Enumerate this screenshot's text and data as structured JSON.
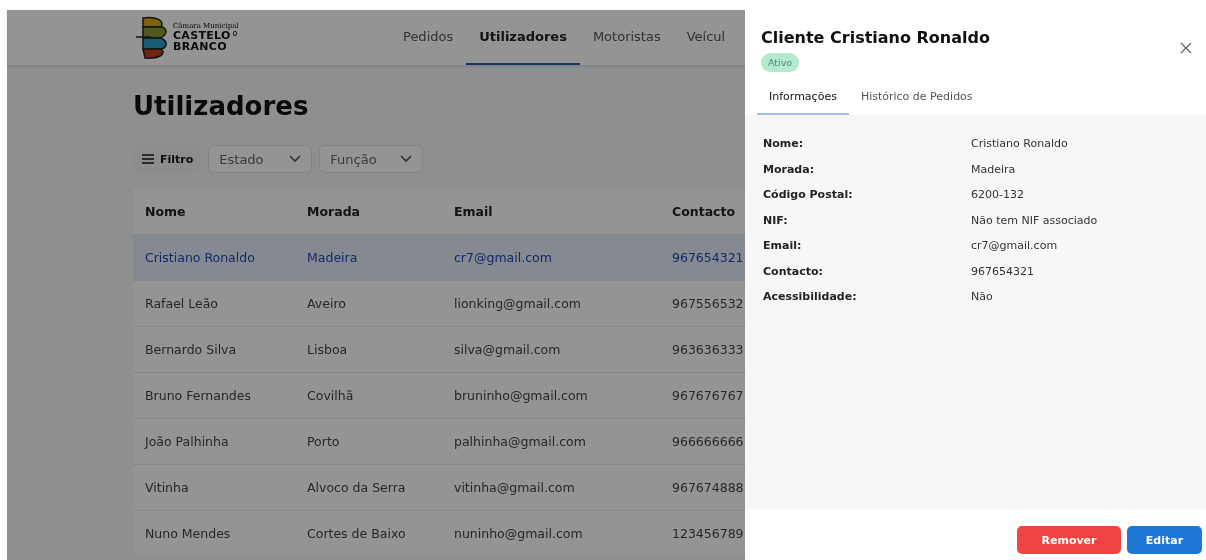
{
  "logo": {
    "subtitle": "Câmara Municipal",
    "name_line1": "CASTELO",
    "name_line2": "BRANCO",
    "mark": "o"
  },
  "nav": [
    {
      "label": "Pedidos",
      "selected": false
    },
    {
      "label": "Utilizadores",
      "selected": true
    },
    {
      "label": "Motoristas",
      "selected": false
    },
    {
      "label": "Veícul",
      "selected": false
    }
  ],
  "page_title": "Utilizadores",
  "filters": {
    "filter_button": "Filtro",
    "dropdowns": [
      "Estado",
      "Função"
    ]
  },
  "table": {
    "columns": [
      "Nome",
      "Morada",
      "Email",
      "Contacto"
    ],
    "rows": [
      {
        "cells": [
          "Cristiano Ronaldo",
          "Madeira",
          "cr7@gmail.com",
          "967654321"
        ],
        "selected": true
      },
      {
        "cells": [
          "Rafael Leão",
          "Aveiro",
          "lionking@gmail.com",
          "967556532"
        ],
        "selected": false
      },
      {
        "cells": [
          "Bernardo Silva",
          "Lisboa",
          "silva@gmail.com",
          "963636333"
        ],
        "selected": false
      },
      {
        "cells": [
          "Bruno Fernandes",
          "Covilhã",
          "bruninho@gmail.com",
          "967676767"
        ],
        "selected": false
      },
      {
        "cells": [
          "João Palhinha",
          "Porto",
          "palhinha@gmail.com",
          "966666666"
        ],
        "selected": false
      },
      {
        "cells": [
          "Vitinha",
          "Alvoco da Serra",
          "vitinha@gmail.com",
          "967674888"
        ],
        "selected": false
      },
      {
        "cells": [
          "Nuno Mendes",
          "Cortes de Baixo",
          "nuninho@gmail.com",
          "123456789"
        ],
        "selected": false
      }
    ]
  },
  "drawer": {
    "title": "Cliente Cristiano Ronaldo",
    "status": "Ativo",
    "tabs": [
      {
        "label": "Informações",
        "selected": true
      },
      {
        "label": "Histórico de Pedidos",
        "selected": false
      }
    ],
    "fields": [
      {
        "label": "Nome:",
        "value": "Cristiano Ronaldo"
      },
      {
        "label": "Morada:",
        "value": "Madeira"
      },
      {
        "label": "Código Postal:",
        "value": "6200-132"
      },
      {
        "label": "NIF:",
        "value": "Não tem NIF associado"
      },
      {
        "label": "Email:",
        "value": "cr7@gmail.com"
      },
      {
        "label": "Contacto:",
        "value": "967654321"
      },
      {
        "label": "Acessibilidade:",
        "value": "Não"
      }
    ],
    "buttons": [
      {
        "label": "Remover",
        "kind": "danger"
      },
      {
        "label": "Editar",
        "kind": "primary"
      }
    ]
  }
}
